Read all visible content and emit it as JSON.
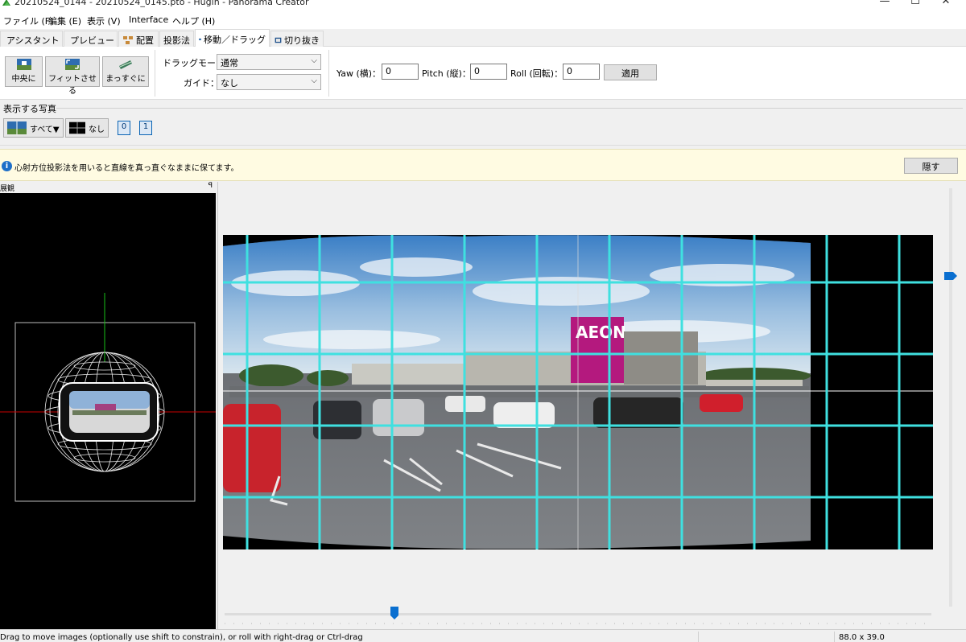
{
  "window": {
    "title": "20210524_0144 - 20210524_0145.pto - Hugin - Panorama Creator",
    "minimize_glyph": "—",
    "maximize_glyph": "☐",
    "close_glyph": "✕"
  },
  "menu": [
    "ファイル (F)",
    "編集 (E)",
    "表示 (V)",
    "Interface",
    "ヘルプ (H)"
  ],
  "tabs": [
    {
      "label": "アシスタント",
      "icon": "wizard-icon"
    },
    {
      "label": "プレビュー",
      "icon": "preview-icon"
    },
    {
      "label": "配置",
      "icon": "layout-icon"
    },
    {
      "label": "投影法",
      "icon": "projection-icon"
    },
    {
      "label": "移動／ドラッグ",
      "icon": "move-drag-icon",
      "active": true
    },
    {
      "label": "切り抜き",
      "icon": "crop-icon"
    }
  ],
  "toolbar": {
    "center_label": "中央に",
    "fit_label": "フィットさせる",
    "straighten_label": "まっすぐに",
    "drag_mode_label": "ドラッグモード：",
    "drag_mode_value": "通常",
    "guide_label": "ガイド：",
    "guide_value": "なし",
    "yaw_label": "Yaw (横)：",
    "yaw_value": "0",
    "pitch_label": "Pitch (縦)：",
    "pitch_value": "0",
    "roll_label": "Roll (回転)：",
    "roll_value": "0",
    "apply_label": "適用"
  },
  "shown_photos": {
    "section_label": "表示する写真",
    "all_label": "すべて▼",
    "none_label": "なし",
    "image_buttons": [
      "0",
      "1"
    ]
  },
  "infobar": {
    "icon": "info-icon",
    "message": "心射方位投影法を用いると直線を真っ直ぐなままに保てます。",
    "hide_label": "隠す"
  },
  "overview": {
    "title": "展観",
    "pin_glyph": "ꟼ"
  },
  "preview": {
    "scene_sign": "AEON",
    "slider_fraction": 0.24
  },
  "statusbar": {
    "message": "Drag to move images (optionally use shift to constrain), or roll with right-drag or Ctrl-drag",
    "dimensions": "88.0 x 39.0"
  },
  "colors": {
    "grid": "#3fe0e0",
    "accent": "#1e6fc8",
    "info_bg": "#fffbe2"
  }
}
